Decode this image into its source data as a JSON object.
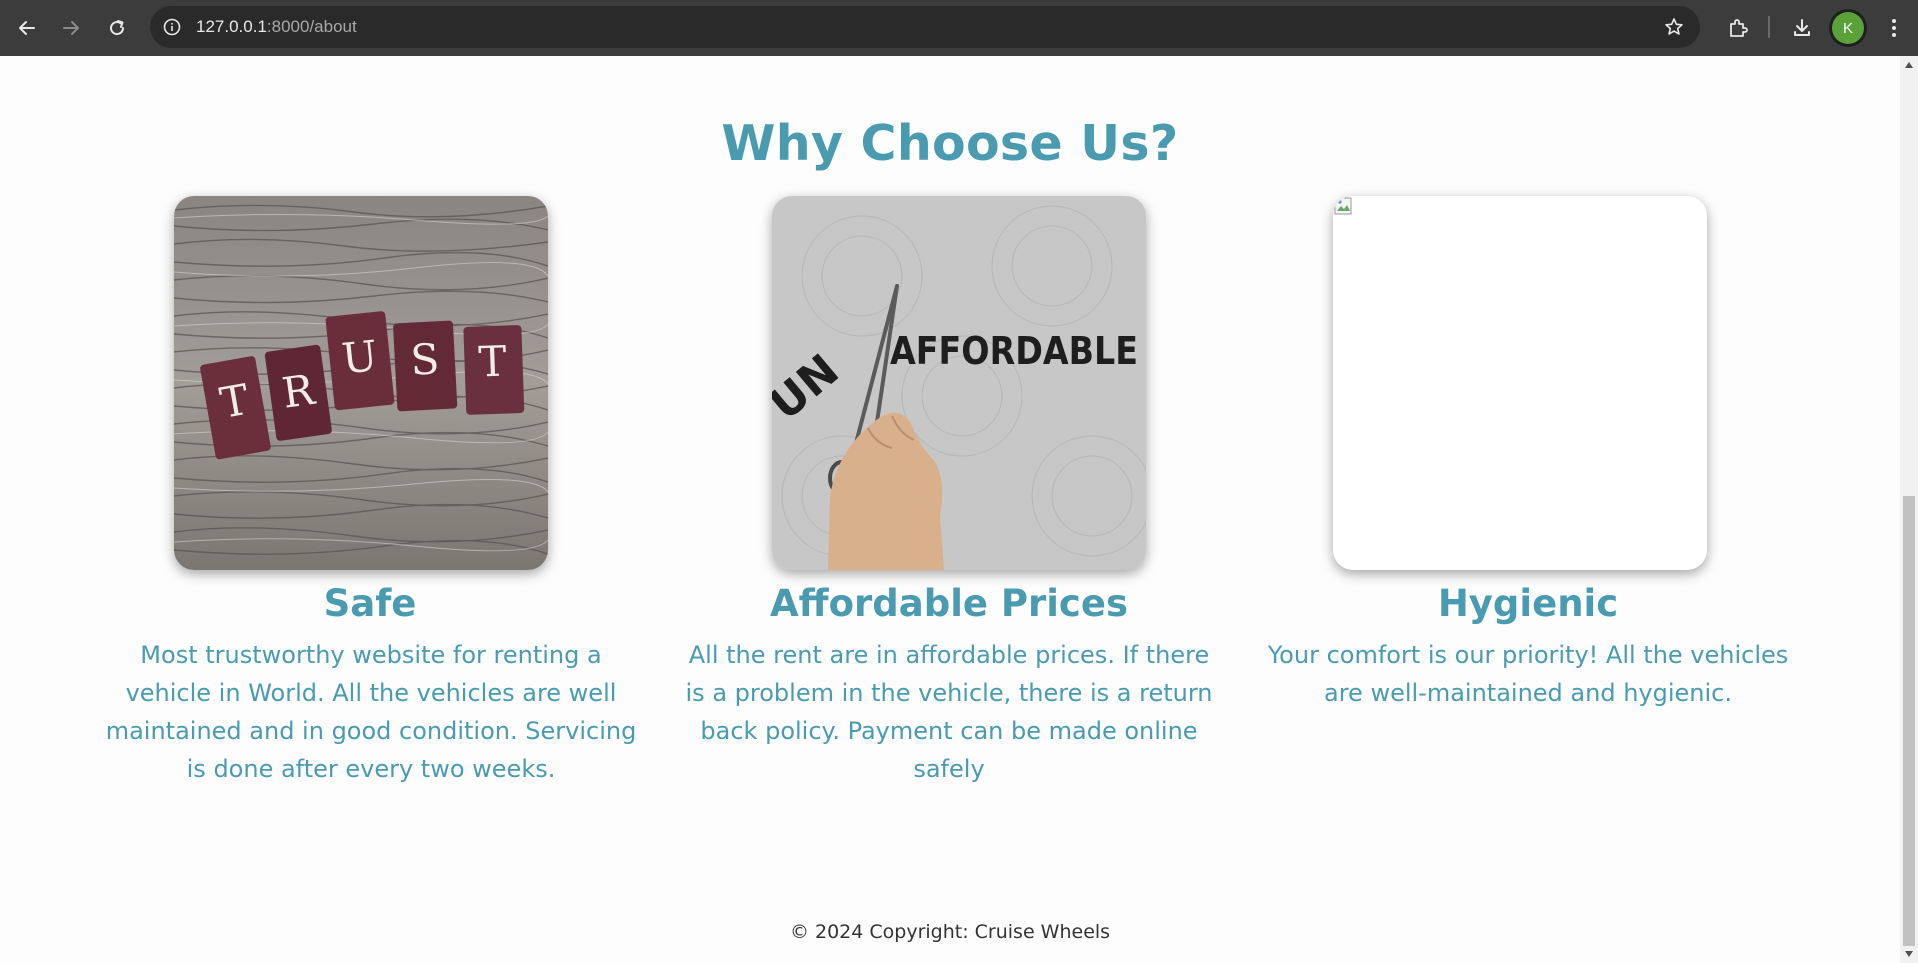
{
  "browser": {
    "url_host": "127.0.0.1",
    "url_path": ":8000/about",
    "profile_initial": "K"
  },
  "page": {
    "heading": "Why Choose Us?",
    "cards": [
      {
        "title": "Safe",
        "description": "Most trustworthy website for renting a vehicle in World. All the vehicles are well maintained and in good condition. Servicing is done after every two weeks.",
        "image_tiles": [
          "T",
          "R",
          "U",
          "S",
          "T"
        ]
      },
      {
        "title": "Affordable Prices",
        "description": "All the rent are in affordable prices. If there is a problem in the vehicle, there is a return back policy. Payment can be made online safely",
        "image_prefix": "UN",
        "image_word": "AFFORDABLE"
      },
      {
        "title": "Hygienic",
        "description": "Your comfort is our priority! All the vehicles are well-maintained and hygienic."
      }
    ],
    "footer": "© 2024 Copyright: Cruise Wheels"
  },
  "colors": {
    "accent": "#4a9bb0",
    "chrome": "#3c3c3c",
    "omnibox": "#2a2a2a"
  }
}
